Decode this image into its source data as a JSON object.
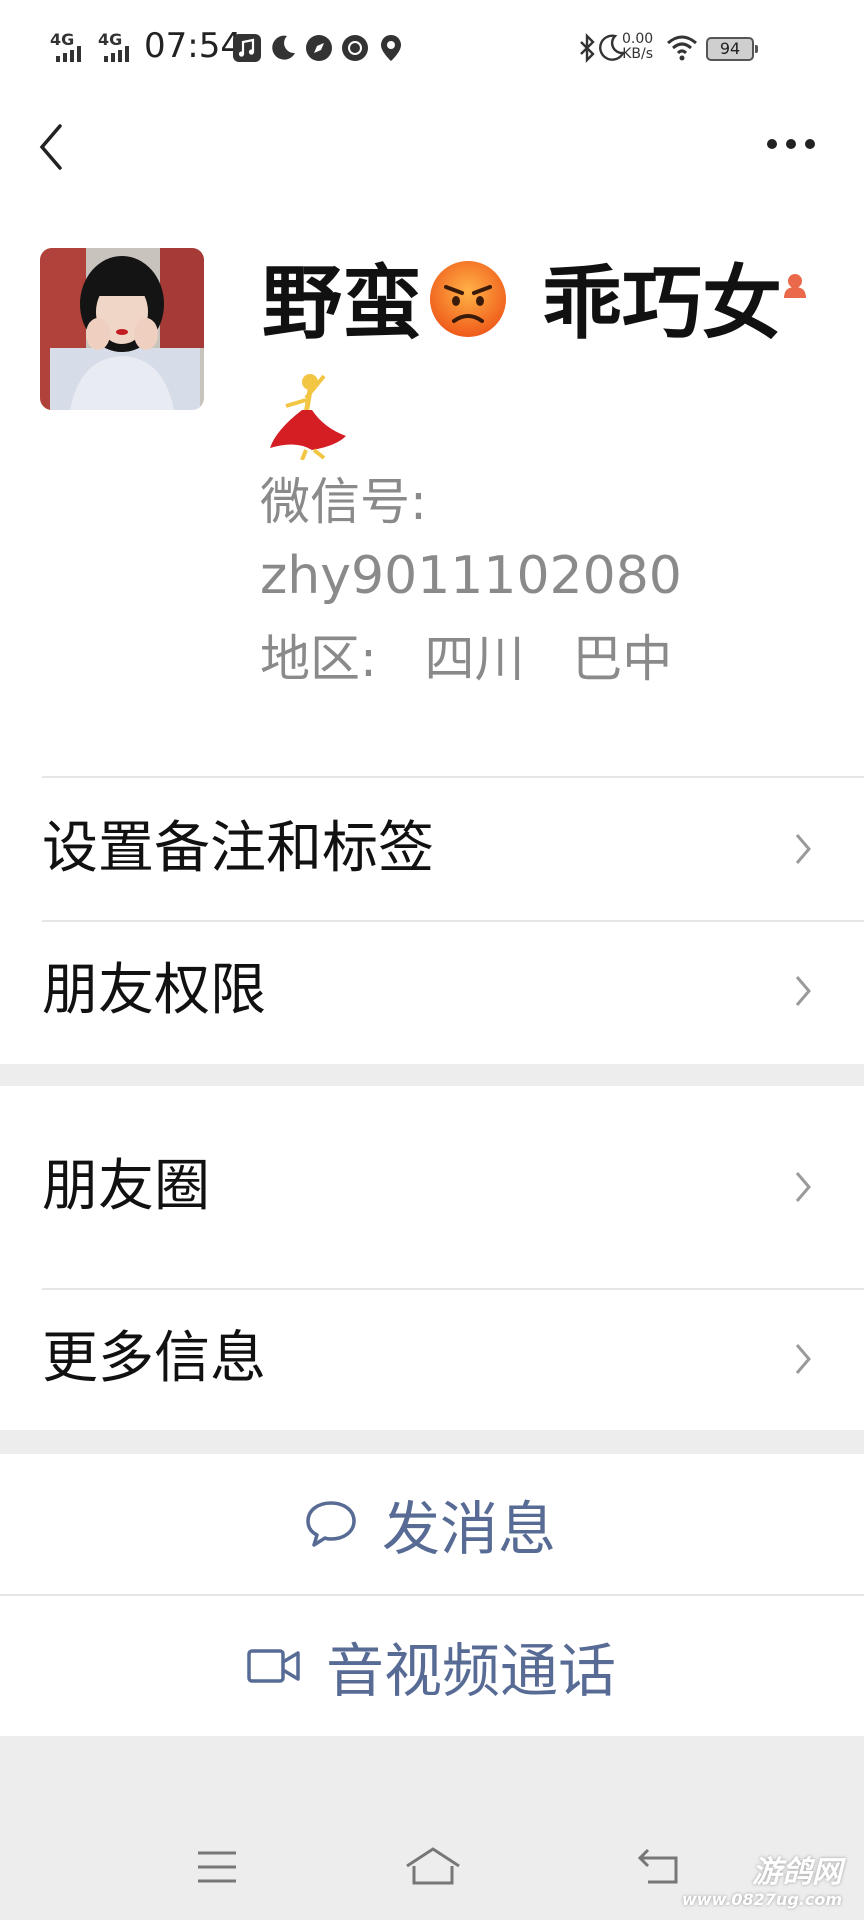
{
  "status_bar": {
    "network1": "4G",
    "network2": "4G",
    "time": "07:54",
    "speed_value": "0.00",
    "speed_unit": "KB/s",
    "battery": "94"
  },
  "header": {
    "back_icon": "chevron-left-icon",
    "more_icon": "more-dots-icon"
  },
  "profile": {
    "name_part1": "野蛮",
    "name_part2": "乖巧女",
    "wechat_id_label": "微信号:",
    "wechat_id": "zhy9011102080",
    "region": "地区:   四川   巴中"
  },
  "menu": {
    "remark_tags": "设置备注和标签",
    "friend_permissions": "朋友权限",
    "moments": "朋友圈",
    "more_info": "更多信息"
  },
  "actions": {
    "send_message": "发消息",
    "video_call": "音视频通话"
  },
  "watermark": {
    "line1": "游鸽网",
    "line2": "www.0827ug.com"
  },
  "colors": {
    "link_blue": "#576b95",
    "divider": "#e6e6e6",
    "background": "#ededed"
  }
}
